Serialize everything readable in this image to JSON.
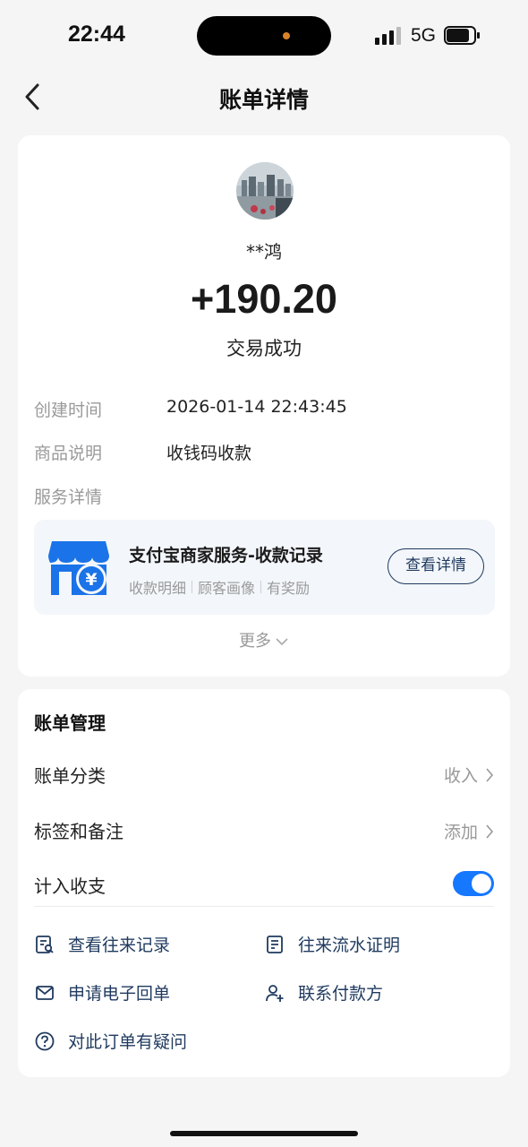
{
  "status_bar": {
    "time": "22:44",
    "network": "5G"
  },
  "nav": {
    "title": "账单详情"
  },
  "transaction": {
    "payer_name": "**鸿",
    "amount": "+190.20",
    "status": "交易成功",
    "fields": [
      {
        "label": "创建时间",
        "value": "2026-01-14 22:43:45"
      },
      {
        "label": "商品说明",
        "value": "收钱码收款"
      },
      {
        "label": "服务详情",
        "value": ""
      }
    ]
  },
  "service": {
    "title": "支付宝商家服务-收款记录",
    "tags": [
      "收款明细",
      "顾客画像",
      "有奖励"
    ],
    "button": "查看详情"
  },
  "more_label": "更多",
  "management": {
    "title": "账单管理",
    "category_label": "账单分类",
    "category_value": "收入",
    "tags_label": "标签和备注",
    "tags_value": "添加",
    "count_label": "计入收支",
    "count_enabled": true
  },
  "links": {
    "history": "查看往来记录",
    "proof": "往来流水证明",
    "receipt": "申请电子回单",
    "contact": "联系付款方",
    "question": "对此订单有疑问"
  },
  "colors": {
    "accent": "#1677ff",
    "link": "#1f3a5f",
    "shop_blue": "#1a73e8"
  }
}
